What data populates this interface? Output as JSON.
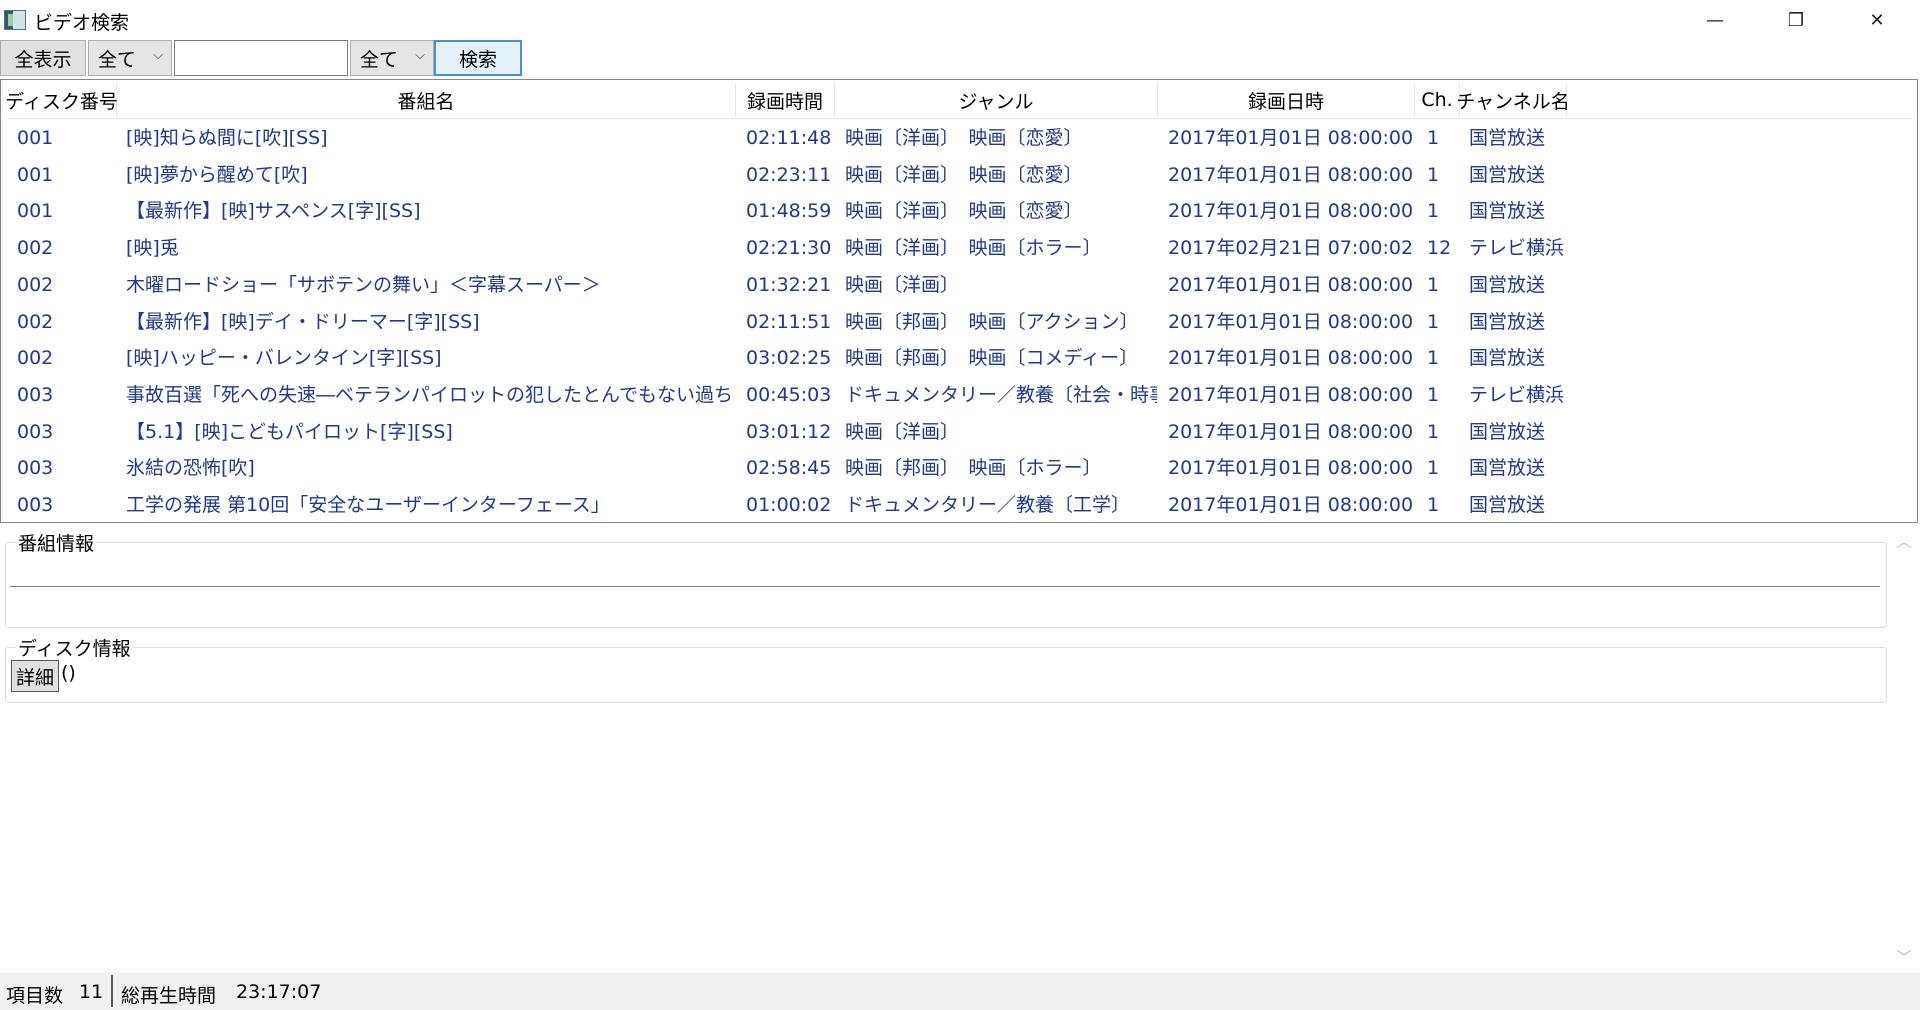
{
  "window": {
    "title": "ビデオ検索",
    "min_icon": "—",
    "max_icon": "❐",
    "close_icon": "✕"
  },
  "toolbar": {
    "show_all_label": "全表示",
    "filter1_value": "全て",
    "search_value": "",
    "filter2_value": "全て",
    "search_label": "検索"
  },
  "table": {
    "columns": [
      "ディスク番号",
      "番組名",
      "録画時間",
      "ジャンル",
      "録画日時",
      "Ch.",
      "チャンネル名"
    ],
    "rows": [
      {
        "disc": "001",
        "title": "[映]知らぬ間に[吹][SS]",
        "duration": "02:11:48",
        "genre": "映画〔洋画〕　映画〔恋愛〕",
        "datetime": "2017年01月01日 08:00:00",
        "ch": "1",
        "channel": "国営放送"
      },
      {
        "disc": "001",
        "title": "[映]夢から醒めて[吹]",
        "duration": "02:23:11",
        "genre": "映画〔洋画〕　映画〔恋愛〕",
        "datetime": "2017年01月01日 08:00:00",
        "ch": "1",
        "channel": "国営放送"
      },
      {
        "disc": "001",
        "title": "【最新作】[映]サスペンス[字][SS]",
        "duration": "01:48:59",
        "genre": "映画〔洋画〕　映画〔恋愛〕",
        "datetime": "2017年01月01日 08:00:00",
        "ch": "1",
        "channel": "国営放送"
      },
      {
        "disc": "002",
        "title": "[映]兎",
        "duration": "02:21:30",
        "genre": "映画〔洋画〕　映画〔ホラー〕",
        "datetime": "2017年02月21日 07:00:02",
        "ch": "12",
        "channel": "テレビ横浜"
      },
      {
        "disc": "002",
        "title": "木曜ロードショー「サボテンの舞い」＜字幕スーパー＞",
        "duration": "01:32:21",
        "genre": "映画〔洋画〕",
        "datetime": "2017年01月01日 08:00:00",
        "ch": "1",
        "channel": "国営放送"
      },
      {
        "disc": "002",
        "title": "【最新作】[映]デイ・ドリーマー[字][SS]",
        "duration": "02:11:51",
        "genre": "映画〔邦画〕　映画〔アクション〕",
        "datetime": "2017年01月01日 08:00:00",
        "ch": "1",
        "channel": "国営放送"
      },
      {
        "disc": "002",
        "title": "[映]ハッピー・バレンタイン[字][SS]",
        "duration": "03:02:25",
        "genre": "映画〔邦画〕　映画〔コメディー〕",
        "datetime": "2017年01月01日 08:00:00",
        "ch": "1",
        "channel": "国営放送"
      },
      {
        "disc": "003",
        "title": "事故百選「死への失速―ベテランパイロットの犯したとんでもない過ちとは」",
        "duration": "00:45:03",
        "genre": "ドキュメンタリー／教養〔社会・時事〕",
        "datetime": "2017年01月01日 08:00:00",
        "ch": "1",
        "channel": "テレビ横浜"
      },
      {
        "disc": "003",
        "title": "【5.1】[映]こどもパイロット[字][SS]",
        "duration": "03:01:12",
        "genre": "映画〔洋画〕",
        "datetime": "2017年01月01日 08:00:00",
        "ch": "1",
        "channel": "国営放送"
      },
      {
        "disc": "003",
        "title": "氷結の恐怖[吹]",
        "duration": "02:58:45",
        "genre": "映画〔邦画〕　映画〔ホラー〕",
        "datetime": "2017年01月01日 08:00:00",
        "ch": "1",
        "channel": "国営放送"
      },
      {
        "disc": "003",
        "title": "工学の発展 第10回「安全なユーザーインターフェース」",
        "duration": "01:00:02",
        "genre": "ドキュメンタリー／教養〔工学〕",
        "datetime": "2017年01月01日 08:00:00",
        "ch": "1",
        "channel": "国営放送"
      }
    ]
  },
  "program_info": {
    "label": "番組情報"
  },
  "disk_info": {
    "label": "ディスク情報",
    "detail_label": "詳細",
    "text": "()"
  },
  "status": {
    "item_count_label": "項目数",
    "item_count": "11",
    "total_time_label": "総再生時間",
    "total_time": "23:17:07"
  }
}
